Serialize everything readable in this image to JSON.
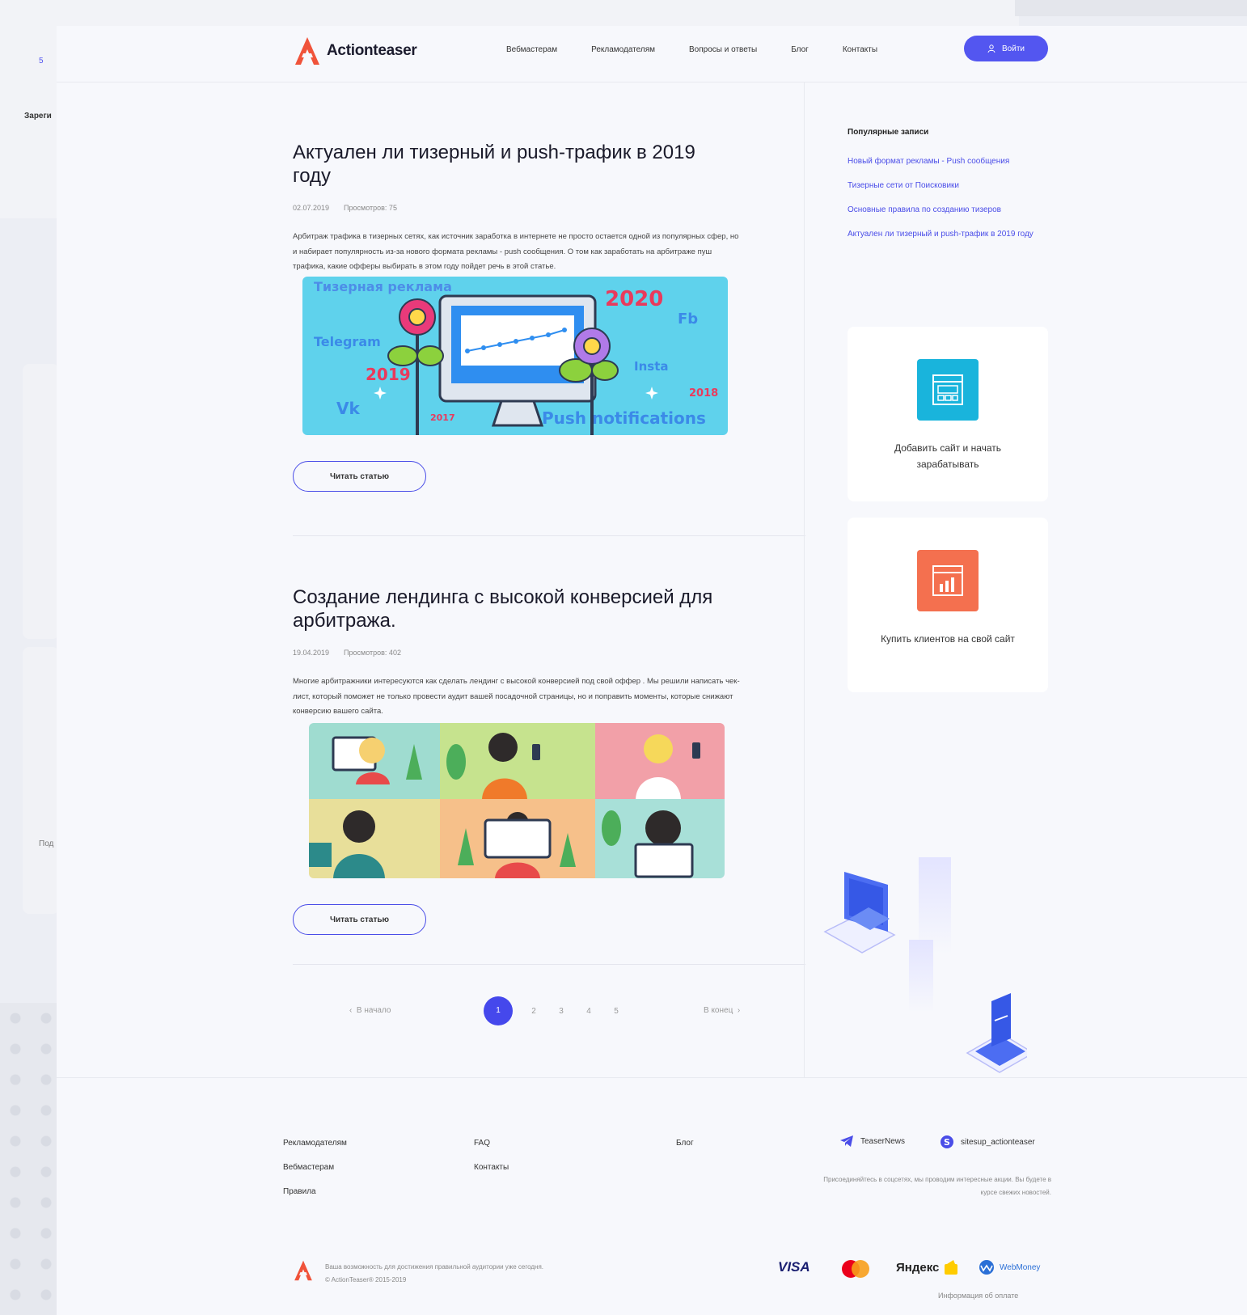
{
  "brand": {
    "name": "Actionteaser",
    "accent": "#4a4de8",
    "logo_color": "#f0533a"
  },
  "backdrop": {
    "badge": "5",
    "left_text_1": "Зареги",
    "left_text_2": "Под"
  },
  "header": {
    "nav": [
      "Вебмастерам",
      "Рекламодателям",
      "Вопросы и ответы",
      "Блог",
      "Контакты"
    ],
    "login_label": "Войти"
  },
  "articles": [
    {
      "title": "Актуален ли тизерный и push-трафик в 2019 году",
      "date": "02.07.2019",
      "views": "Просмотров: 75",
      "excerpt": "Арбитраж трафика в тизерных сетях, как источник заработка в интернете не просто остается одной из популярных сфер, но и набирает популярность из-за нового формата рекламы - push сообщения. О том как заработать на арбитраже пуш трафика, какие офферы выбирать в этом году пойдет речь в этой статье.",
      "read_label": "Читать статью",
      "image": {
        "words": [
          "Тизерная реклама",
          "2020",
          "Fb",
          "Telegram",
          "2019",
          "Insta",
          "Vk",
          "2017",
          "2018",
          "Push notifications"
        ]
      }
    },
    {
      "title": "Создание лендинга с высокой конверсией для арбитража.",
      "date": "19.04.2019",
      "views": "Просмотров: 402",
      "excerpt": "Многие арбитражники интересуются как сделать лендинг с высокой конверсией под свой оффер . Мы решили написать чек-лист, который поможет не только провести аудит вашей посадочной страницы, но и поправить моменты, которые снижают конверсию вашего сайта.",
      "read_label": "Читать статью"
    }
  ],
  "pagination": {
    "prev_label": "В начало",
    "next_label": "В конец",
    "pages": [
      "1",
      "2",
      "3",
      "4",
      "5"
    ],
    "current": "1"
  },
  "sidebar": {
    "popular_title": "Популярные записи",
    "popular": [
      "Новый формат рекламы - Push сообщения",
      "Тизерные сети от Поисковики",
      "Основные правила по созданию тизеров",
      "Актуален ли тизерный и push-трафик в 2019 году"
    ],
    "cards": [
      {
        "text": "Добавить сайт и начать зарабатывать",
        "color": "#19b4dc"
      },
      {
        "text": "Купить клиентов на свой сайт",
        "color": "#f4704f"
      }
    ]
  },
  "footer": {
    "col1": [
      "Рекламодателям",
      "Вебмастерам",
      "Правила"
    ],
    "col2": [
      "FAQ",
      "Контакты"
    ],
    "col3": [
      "Блог"
    ],
    "telegram": "TeaserNews",
    "skype": "sitesup_actionteaser",
    "note": "Присоединяйтесь в соцсетях, мы проводим интересные акции. Вы будете в курсе свежих новостей.",
    "copy_line1": "Ваша возможность для достижения правильной аудитории уже сегодня.",
    "copy_line2": "© ActionTeaser® 2015-2019",
    "payments": {
      "visa": "VISA",
      "yandex": "Яндекс",
      "webmoney": "WebMoney"
    },
    "payment_info": "Информация об оплате"
  }
}
